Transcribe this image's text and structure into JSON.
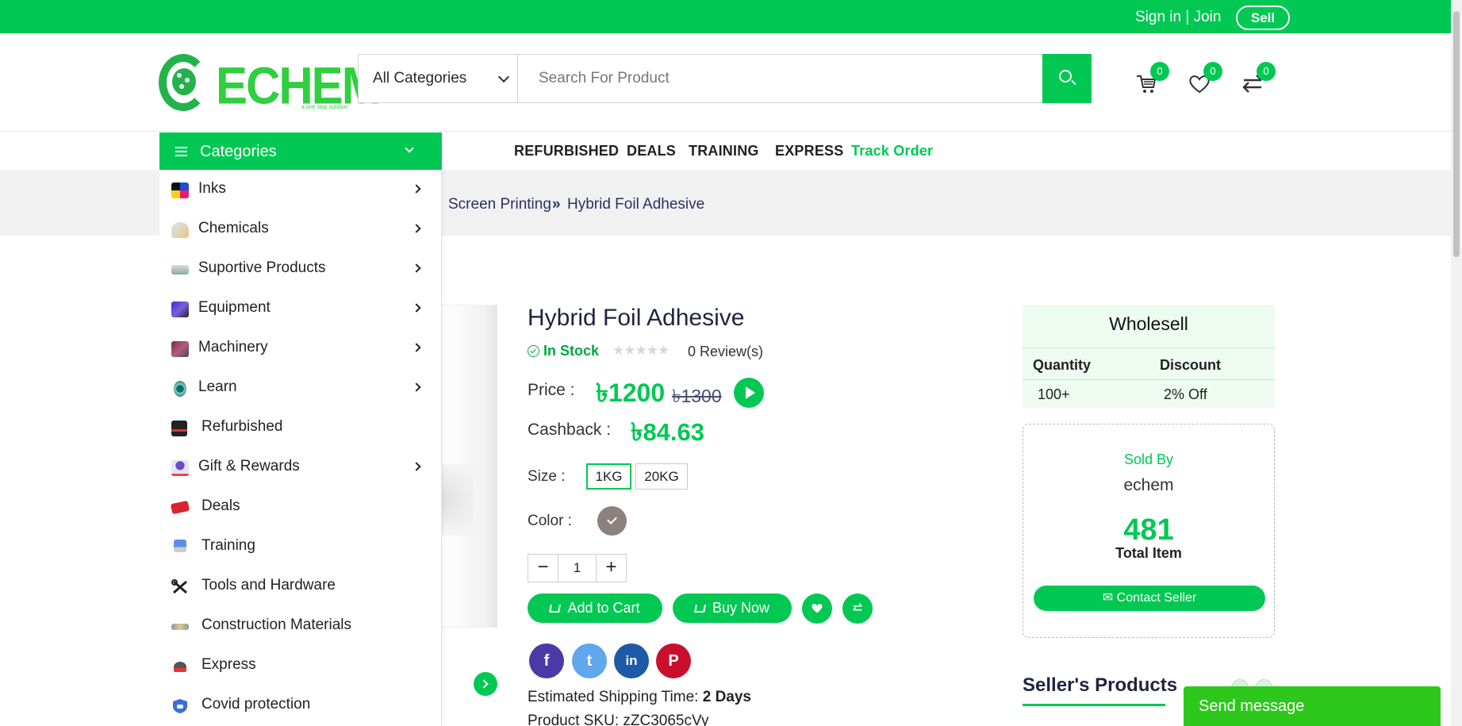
{
  "topbar": {
    "sign_in": "Sign in",
    "divider": "|",
    "join": "Join",
    "sell": "Sell"
  },
  "header": {
    "logo_text": "ECHEM",
    "logo_tagline": "a one stop solution",
    "category_select": "All Categories",
    "search_placeholder": "Search For Product",
    "cart_count": "0",
    "wishlist_count": "0",
    "compare_count": "0"
  },
  "nav": {
    "categories_label": "Categories",
    "links": [
      "REFURBISHED",
      "DEALS",
      "TRAINING",
      "EXPRESS",
      "Track Order"
    ]
  },
  "breadcrumb": {
    "items": [
      "Screen Printing",
      "Hybrid Foil Adhesive"
    ],
    "separator": "»"
  },
  "categories_menu": [
    {
      "label": "Inks",
      "has_sub": true,
      "icon": "inks-icon"
    },
    {
      "label": "Chemicals",
      "has_sub": true,
      "icon": "chemicals-icon"
    },
    {
      "label": "Suportive Products",
      "has_sub": true,
      "icon": "supportive-products-icon"
    },
    {
      "label": "Equipment",
      "has_sub": true,
      "icon": "equipment-icon"
    },
    {
      "label": "Machinery",
      "has_sub": true,
      "icon": "machinery-icon"
    },
    {
      "label": "Learn",
      "has_sub": true,
      "icon": "learn-icon"
    },
    {
      "label": "Refurbished",
      "has_sub": false,
      "icon": "refurbished-icon"
    },
    {
      "label": "Gift & Rewards",
      "has_sub": true,
      "icon": "gift-icon"
    },
    {
      "label": "Deals",
      "has_sub": false,
      "icon": "deals-icon"
    },
    {
      "label": "Training",
      "has_sub": false,
      "icon": "training-icon"
    },
    {
      "label": "Tools and Hardware",
      "has_sub": false,
      "icon": "tools-icon"
    },
    {
      "label": "Construction Materials",
      "has_sub": false,
      "icon": "construction-icon"
    },
    {
      "label": "Express",
      "has_sub": false,
      "icon": "express-icon"
    },
    {
      "label": "Covid protection",
      "has_sub": false,
      "icon": "covid-shield-icon"
    }
  ],
  "product": {
    "title": "Hybrid Foil Adhesive",
    "stock": "In Stock",
    "stars": "★★★★★",
    "reviews": "0 Review(s)",
    "price_label": "Price :",
    "price": "৳1200",
    "old_price": "৳1300",
    "cashback_label": "Cashback :",
    "cashback": "৳84.63",
    "size_label": "Size :",
    "sizes": [
      "1KG",
      "20KG"
    ],
    "selected_size": "1KG",
    "color_label": "Color :",
    "color": "#8f8080",
    "quantity": "1",
    "qty_minus": "−",
    "qty_plus": "+",
    "add_to_cart": "Add to Cart",
    "buy_now": "Buy Now",
    "social": [
      "f",
      "t",
      "in",
      "P"
    ],
    "shipping_label": "Estimated Shipping Time:",
    "shipping_value": "2 Days",
    "sku_label": "Product SKU:",
    "sku_value": "zZC3065cVy"
  },
  "wholesale": {
    "title": "Wholesell",
    "col_quantity": "Quantity",
    "col_discount": "Discount",
    "rows": [
      {
        "quantity": "100+",
        "discount": "2% Off"
      }
    ]
  },
  "seller": {
    "sold_by": "Sold By",
    "name": "echem",
    "total_items": "481",
    "total_label": "Total Item",
    "contact": "Contact Seller"
  },
  "sellers_products": {
    "title": "Seller's Products"
  },
  "chat": {
    "label": "Send message"
  },
  "colors": {
    "brand_green": "#00c853",
    "text_navy": "#1f2440"
  }
}
